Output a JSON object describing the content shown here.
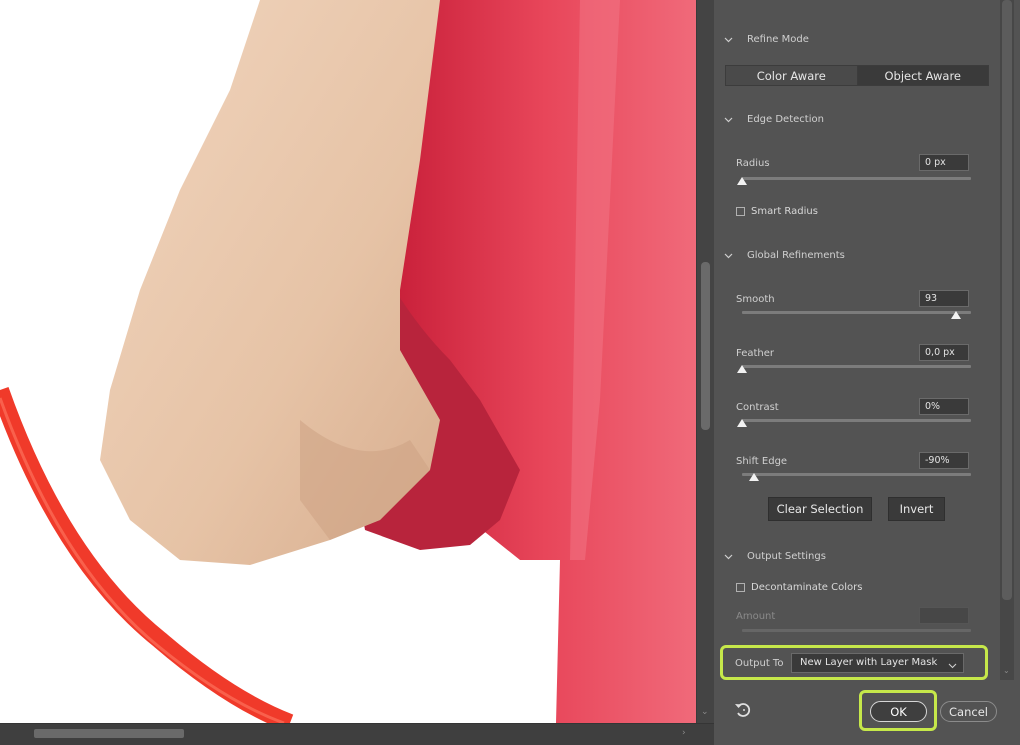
{
  "refine_mode": {
    "title": "Refine Mode",
    "options": [
      "Color Aware",
      "Object Aware"
    ],
    "selected": "Object Aware"
  },
  "edge_detection": {
    "title": "Edge Detection",
    "radius": {
      "label": "Radius",
      "value": "0 px",
      "level": 0.0
    },
    "smart_radius": {
      "label": "Smart Radius",
      "checked": false
    }
  },
  "global_refinements": {
    "title": "Global Refinements",
    "smooth": {
      "label": "Smooth",
      "value": "93",
      "level": 0.93
    },
    "feather": {
      "label": "Feather",
      "value": "0,0 px",
      "level": 0.0
    },
    "contrast": {
      "label": "Contrast",
      "value": "0%",
      "level": 0.0
    },
    "shift_edge": {
      "label": "Shift Edge",
      "value": "-90%",
      "level": 0.05
    }
  },
  "actions": {
    "clear_selection": "Clear Selection",
    "invert": "Invert"
  },
  "output_settings": {
    "title": "Output Settings",
    "decontaminate": {
      "label": "Decontaminate Colors",
      "checked": false
    },
    "amount": {
      "label": "Amount",
      "value": ""
    },
    "output_to": {
      "label": "Output To",
      "value": "New Layer with Layer Mask"
    }
  },
  "footer": {
    "ok": "OK",
    "cancel": "Cancel"
  },
  "colors": {
    "highlight": "#c6e84a",
    "panel": "#535353",
    "shirt": "#e8465a",
    "hoop": "#f03a2a"
  }
}
